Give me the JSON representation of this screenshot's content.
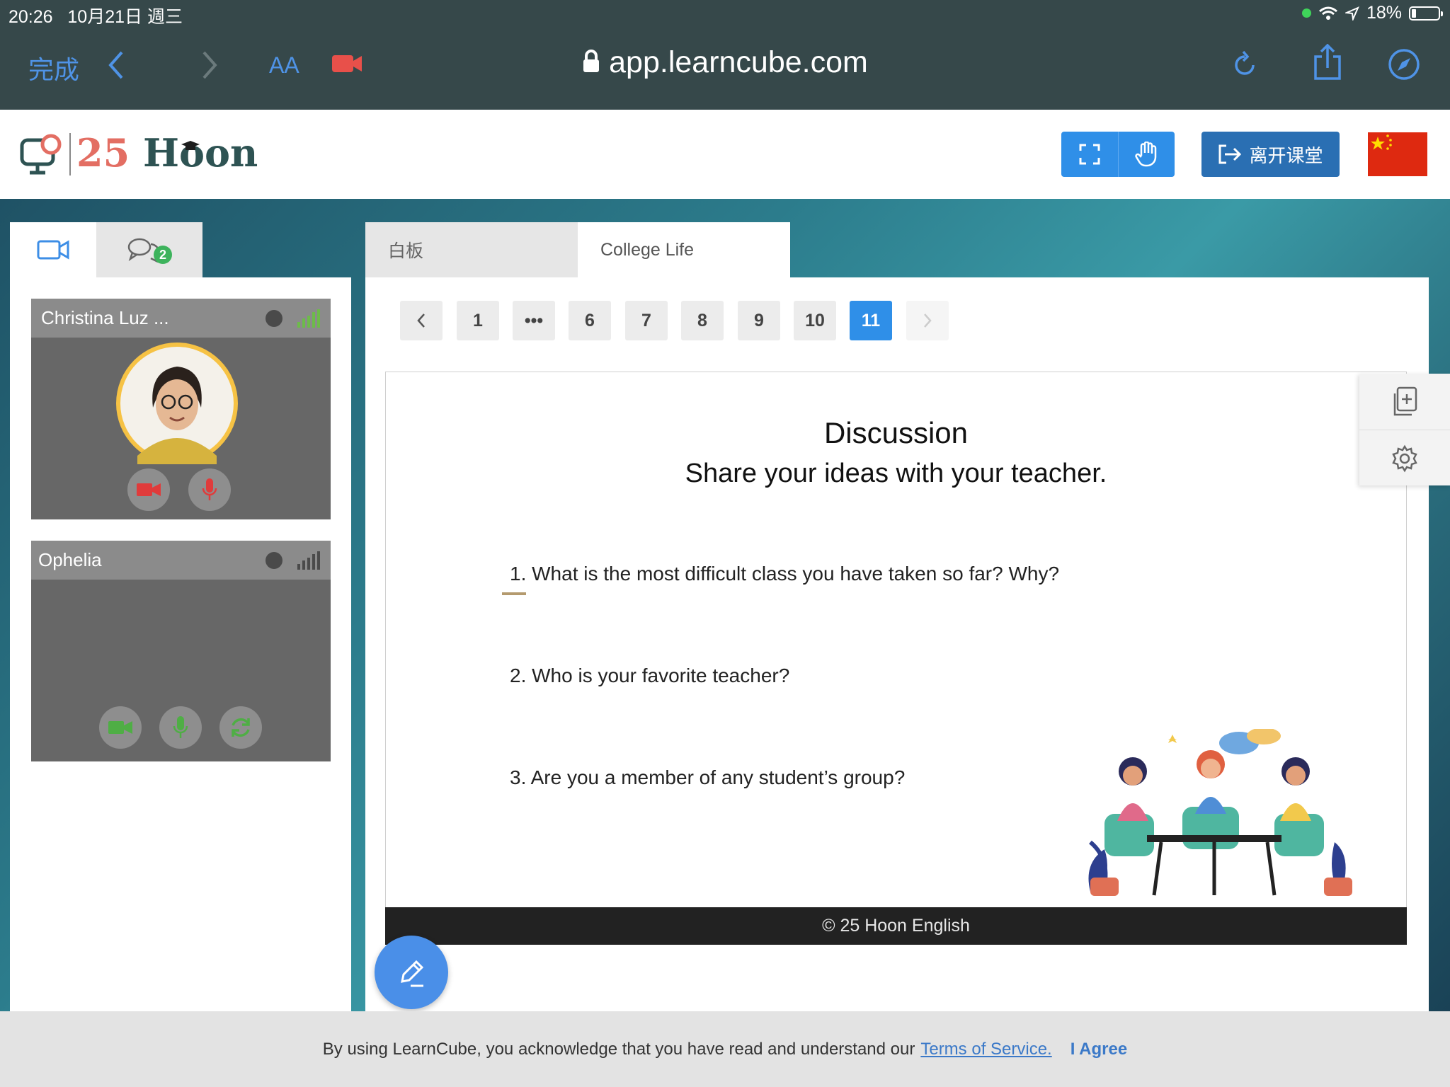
{
  "status": {
    "time": "20:26",
    "date": "10月21日 週三",
    "battery": "18%"
  },
  "safari": {
    "done": "完成",
    "text_size": "AA",
    "url": "app.learncube.com"
  },
  "header": {
    "logo_num": "25",
    "logo_word": "Hoon",
    "leave_label": "离开课堂"
  },
  "left": {
    "chat_badge": "2",
    "tiles": [
      {
        "name": "Christina Luz ..."
      },
      {
        "name": "Ophelia"
      }
    ]
  },
  "main": {
    "tabs": [
      {
        "label": "白板"
      },
      {
        "label": "College Life"
      }
    ],
    "pagination": [
      "1",
      "•••",
      "6",
      "7",
      "8",
      "9",
      "10",
      "11"
    ],
    "active_page": "11",
    "slide": {
      "title": "Discussion",
      "subtitle": "Share your ideas with your teacher.",
      "questions": [
        "1. What is the most difficult class you have taken so far? Why?",
        "2. Who is your favorite teacher?",
        "3. Are you a member of any student’s group?"
      ],
      "footer": "© 25 Hoon English"
    }
  },
  "cookie": {
    "text": "By using LearnCube, you acknowledge that you have read and understand our",
    "tos": "Terms of Service.",
    "agree": "I Agree"
  },
  "colors": {
    "accent": "#2f8fe8",
    "leave": "#2a6fb3",
    "safari_bar": "#36484a",
    "logo_red": "#e36e63",
    "logo_dark": "#2e5353"
  }
}
